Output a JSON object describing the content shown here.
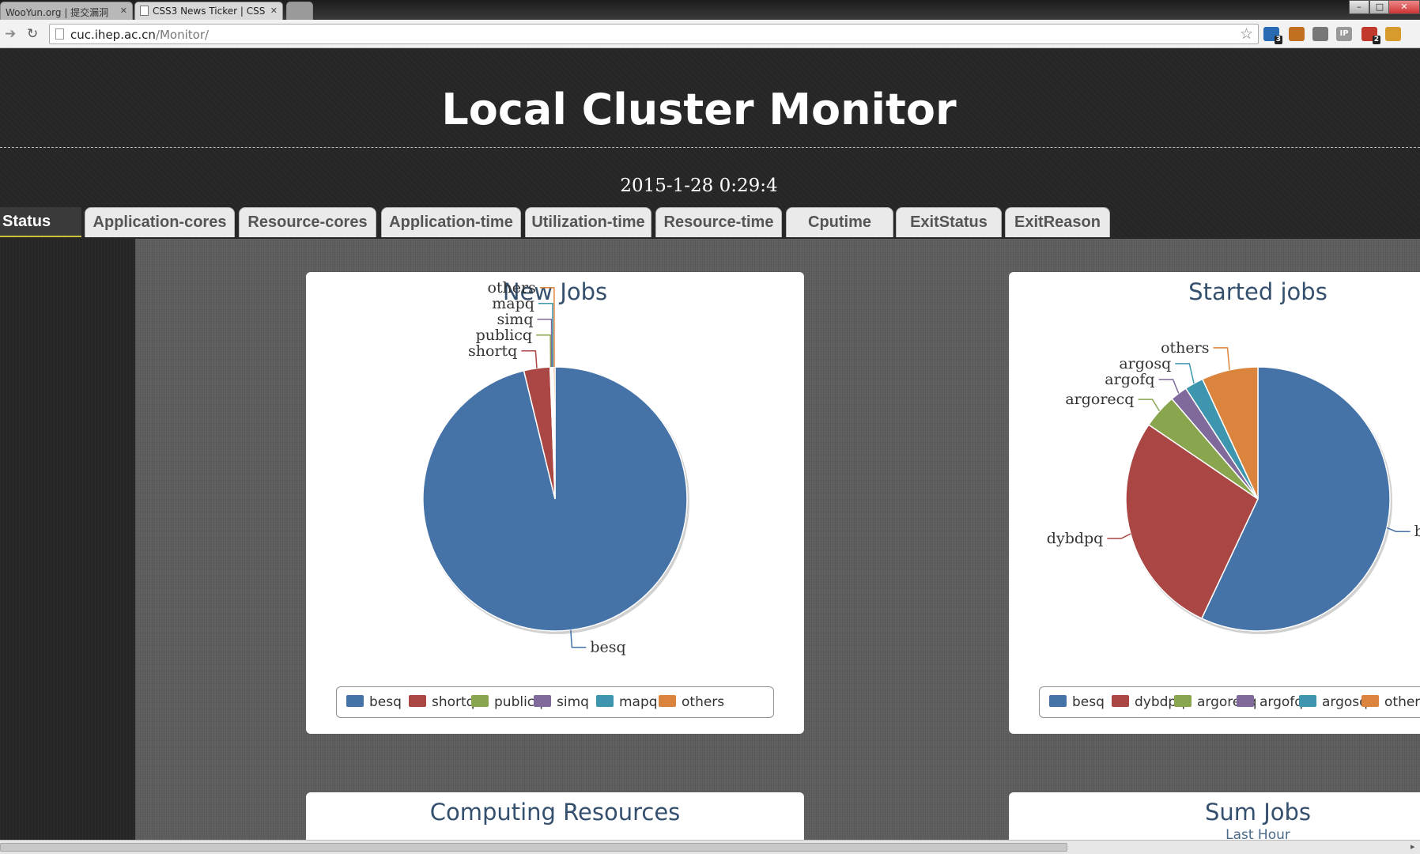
{
  "browser": {
    "tabs": [
      {
        "title": "WooYun.org | 提交漏洞"
      },
      {
        "title": "CSS3 News Ticker | CSS"
      }
    ],
    "url_host": "cuc.ihep.ac.cn",
    "url_path": "/Monitor/",
    "extensions": [
      {
        "icon": "s-ext-icon",
        "badge": "3",
        "color": "#2a6ab3"
      },
      {
        "icon": "people-ext-icon",
        "color": "#c07020"
      },
      {
        "icon": "window-ext-icon",
        "color": "#777777"
      },
      {
        "icon": "ip-ext-icon",
        "label": "IP",
        "color": "#999999"
      },
      {
        "icon": "red-ext-icon",
        "badge": "2",
        "color": "#c0392b"
      },
      {
        "icon": "cookie-ext-icon",
        "color": "#d69a2d"
      }
    ]
  },
  "page": {
    "title": "Local Cluster Monitor",
    "datetime": "2015-1-28 0:29:4"
  },
  "nav": {
    "tabs": [
      "Status",
      "Application-cores",
      "Resource-cores",
      "Application-time",
      "Utilization-time",
      "Resource-time",
      "Cputime",
      "ExitStatus",
      "ExitReason"
    ],
    "active": "Status"
  },
  "colors": {
    "besq": "#4572a7",
    "shortq": "#aa4643",
    "publicq": "#89a54e",
    "simq": "#80699b",
    "mapq": "#3d96ae",
    "others": "#db843d"
  },
  "panels": {
    "new_jobs": {
      "title": "New Jobs"
    },
    "started_jobs": {
      "title": "Started jobs"
    },
    "computing_resources": {
      "title": "Computing Resources"
    },
    "sum_jobs": {
      "title": "Sum Jobs",
      "subtitle": "Last Hour"
    }
  },
  "chart_data": [
    {
      "type": "pie",
      "title": "New Jobs",
      "categories": [
        "besq",
        "shortq",
        "publicq",
        "simq",
        "mapq",
        "others"
      ],
      "values": [
        96.2,
        3.2,
        0.15,
        0.1,
        0.15,
        0.2
      ],
      "legend": [
        "besq",
        "shortq",
        "publicq",
        "simq",
        "mapq",
        "others"
      ]
    },
    {
      "type": "pie",
      "title": "Started jobs",
      "categories": [
        "besq",
        "dybdpq",
        "argorecq",
        "argofq",
        "argosq",
        "others"
      ],
      "values": [
        57,
        27.5,
        4.2,
        2.1,
        2.3,
        6.9
      ],
      "legend": [
        "besq",
        "dybdpq",
        "argorecq",
        "argofq",
        "argosq",
        "others"
      ]
    }
  ]
}
